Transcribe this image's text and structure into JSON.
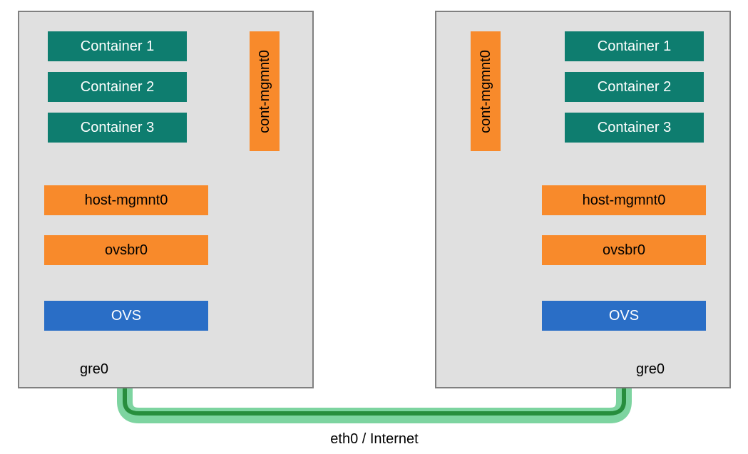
{
  "left_host": {
    "containers": [
      "Container 1",
      "Container 2",
      "Container 3"
    ],
    "cont_mgmnt": "cont-mgmnt0",
    "host_mgmnt": "host-mgmnt0",
    "ovsbr": "ovsbr0",
    "ovs": "OVS",
    "gre": "gre0"
  },
  "right_host": {
    "containers": [
      "Container 1",
      "Container 2",
      "Container 3"
    ],
    "cont_mgmnt": "cont-mgmnt0",
    "host_mgmnt": "host-mgmnt0",
    "ovsbr": "ovsbr0",
    "ovs": "OVS",
    "gre": "gre0"
  },
  "tunnel_label": "eth0 / Internet",
  "colors": {
    "container": "#0e7d6f",
    "orange": "#f88a2b",
    "blue": "#2a6ec6",
    "host_bg": "#e0e0e0",
    "conn_blue": "#2a6ec6",
    "tunnel_outer": "#7dd4a0",
    "tunnel_inner": "#278e3d"
  }
}
